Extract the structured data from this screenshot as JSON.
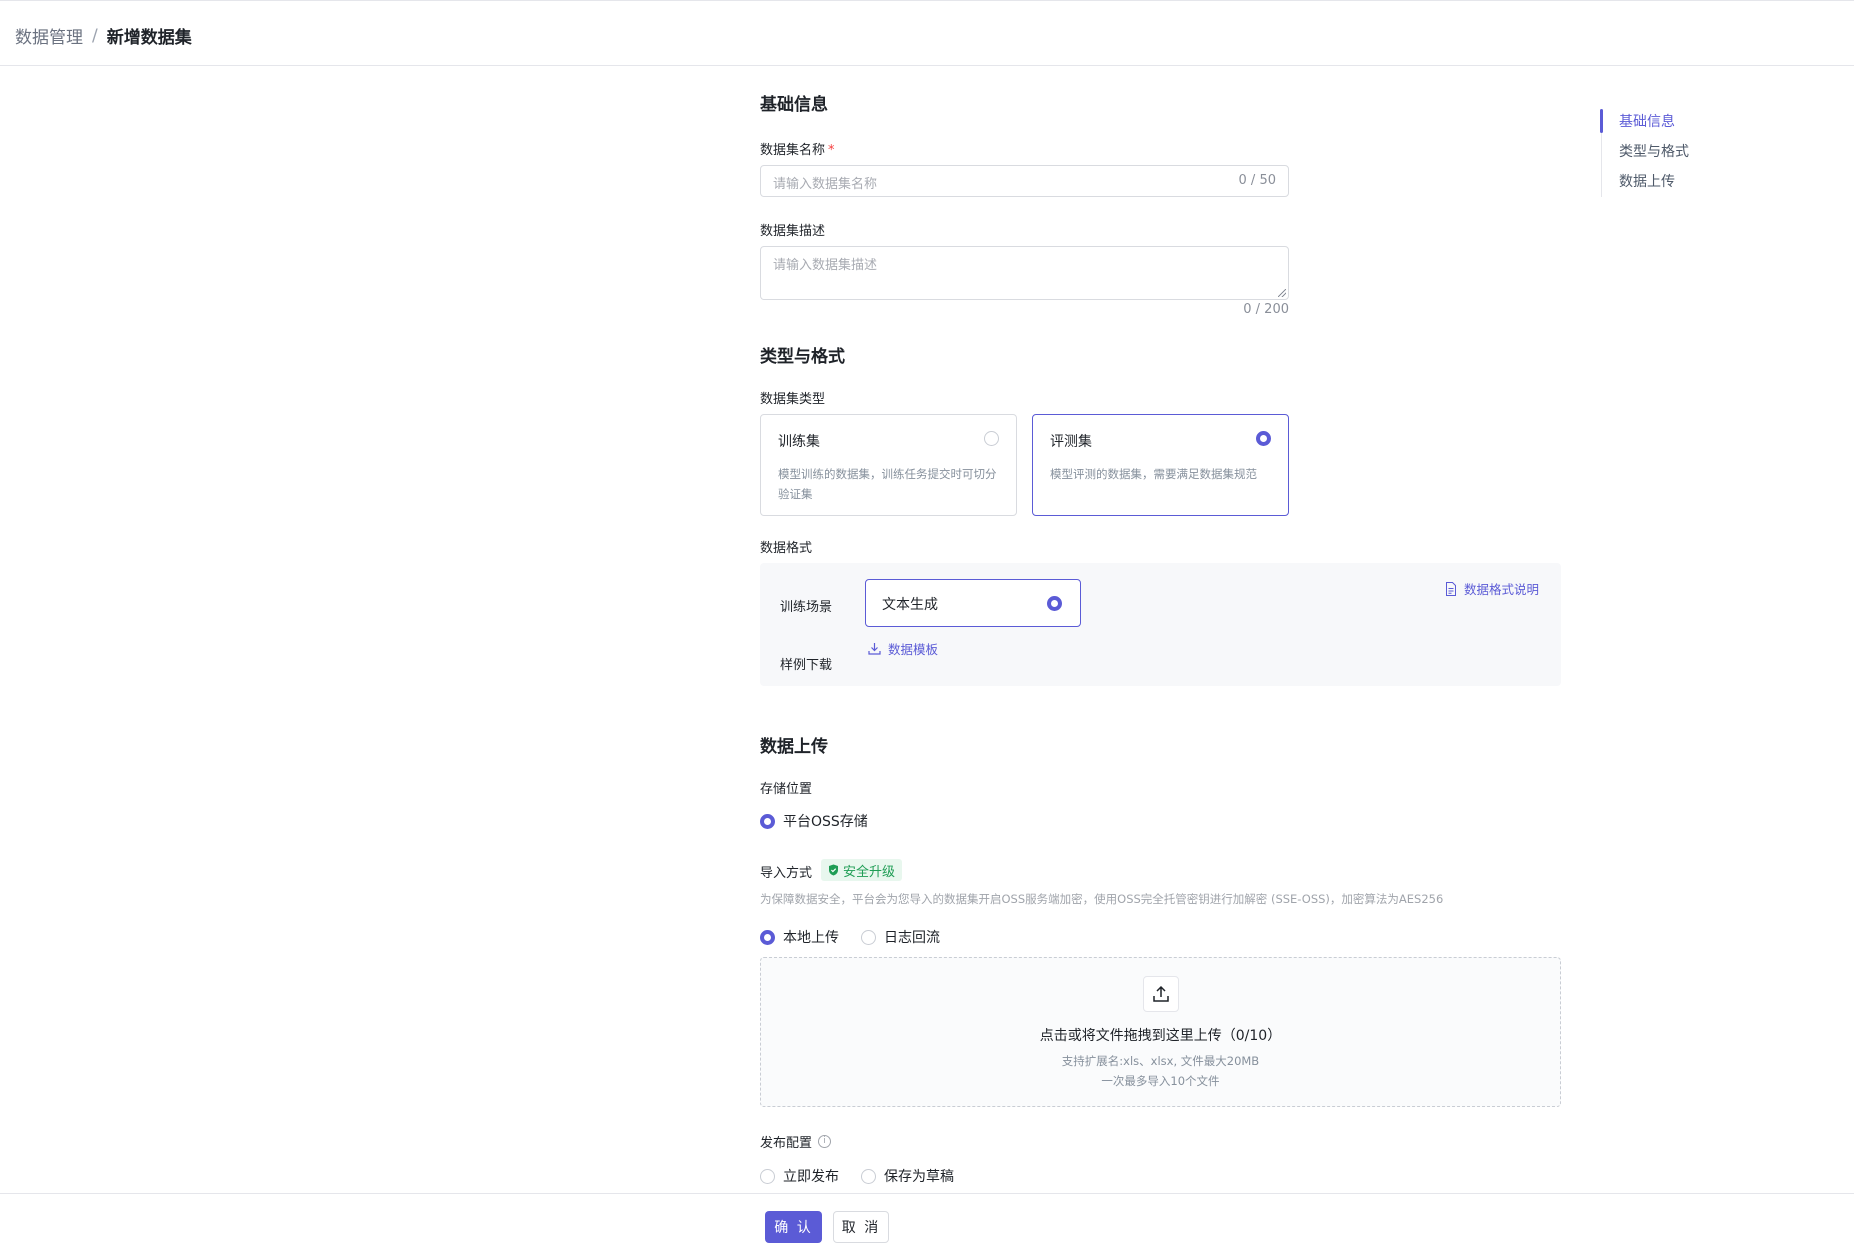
{
  "breadcrumb": {
    "parent": "数据管理",
    "separator": "/",
    "current": "新增数据集"
  },
  "basic": {
    "section_title": "基础信息",
    "name_label": "数据集名称",
    "name_required": "*",
    "name_placeholder": "请输入数据集名称",
    "name_count": "0 / 50",
    "desc_label": "数据集描述",
    "desc_placeholder": "请输入数据集描述",
    "desc_count": "0 / 200"
  },
  "type_format": {
    "section_title": "类型与格式",
    "type_label": "数据集类型",
    "types": [
      {
        "title": "训练集",
        "desc": "模型训练的数据集，训练任务提交时可切分验证集",
        "selected": false
      },
      {
        "title": "评测集",
        "desc": "模型评测的数据集，需要满足数据集规范",
        "selected": true
      }
    ],
    "format_label": "数据格式",
    "scene_label": "训练场景",
    "scene_value": "文本生成",
    "format_doc_link": "数据格式说明",
    "sample_label": "样例下载",
    "template_link": "数据模板"
  },
  "upload": {
    "section_title": "数据上传",
    "storage_label": "存储位置",
    "storage_option": "平台OSS存储",
    "import_label": "导入方式",
    "security_badge": "安全升级",
    "security_hint": "为保障数据安全，平台会为您导入的数据集开启OSS服务端加密，使用OSS完全托管密钥进行加解密 (SSE-OSS)，加密算法为AES256",
    "import_options": [
      {
        "label": "本地上传",
        "selected": true
      },
      {
        "label": "日志回流",
        "selected": false
      }
    ],
    "drop_main": "点击或将文件拖拽到这里上传（0/10）",
    "drop_sub1": "支持扩展名:xls、xlsx, 文件最大20MB",
    "drop_sub2": "一次最多导入10个文件",
    "publish_label": "发布配置",
    "publish_info_icon": "i",
    "publish_options": [
      {
        "label": "立即发布",
        "selected": false
      },
      {
        "label": "保存为草稿",
        "selected": false
      }
    ]
  },
  "anchor": {
    "items": [
      "基础信息",
      "类型与格式",
      "数据上传"
    ],
    "active": 0
  },
  "footer": {
    "confirm_label": "确 认",
    "cancel_label": "取 消"
  },
  "colors": {
    "primary": "#5b5bd6",
    "success": "#1f9d55",
    "border": "#d9dbe0",
    "required": "#f53f3f"
  },
  "icons": {
    "doc": "document-icon",
    "download": "download-icon",
    "upload": "upload-icon",
    "shield": "shield-icon",
    "info": "info-icon"
  }
}
